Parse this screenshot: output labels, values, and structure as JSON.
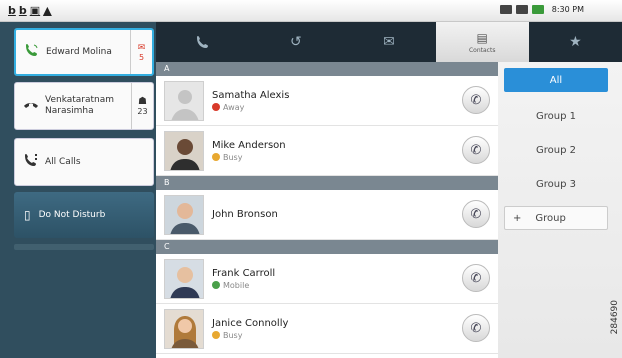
{
  "status_bar": {
    "left_icons": [
      "b-icon",
      "b-icon",
      "signal-icon",
      "warning-icon"
    ],
    "time": "8:30 PM"
  },
  "calls": [
    {
      "name": "Edward Molina",
      "badge": "5",
      "badge_icon": "voicemail-icon"
    },
    {
      "name": "Venkataratnam Narasimha",
      "badge": "23",
      "badge_icon": "user-icon"
    },
    {
      "name": "All Calls"
    },
    {
      "name": "Do Not Disturb"
    }
  ],
  "tabs": [
    {
      "icon": "phone-icon",
      "label": ""
    },
    {
      "icon": "history-icon",
      "label": ""
    },
    {
      "icon": "voicemail-icon",
      "label": ""
    },
    {
      "icon": "contacts-icon",
      "label": "Contacts"
    },
    {
      "icon": "star-icon",
      "label": ""
    }
  ],
  "contacts": {
    "sections": [
      {
        "letter": "A",
        "rows": [
          {
            "name": "Samatha Alexis",
            "status": "Away",
            "status_color": "#d83a2a"
          },
          {
            "name": "Mike Anderson",
            "status": "Busy",
            "status_color": "#e8a830"
          }
        ]
      },
      {
        "letter": "B",
        "rows": [
          {
            "name": "John Bronson",
            "status": "",
            "status_color": ""
          }
        ]
      },
      {
        "letter": "C",
        "rows": [
          {
            "name": "Frank Carroll",
            "status": "Mobile",
            "status_color": "#4aa04a"
          },
          {
            "name": "Janice Connolly",
            "status": "Busy",
            "status_color": "#e8a830"
          }
        ]
      }
    ]
  },
  "groups": {
    "all": "All",
    "items": [
      "Group 1",
      "Group 2",
      "Group 3"
    ],
    "add_label": "Group",
    "add_icon": "+"
  },
  "watermark": "284690",
  "colors": {
    "accent": "#2a8fd8",
    "sidebar": "#304e5e",
    "tabbar": "#1e2b35"
  }
}
